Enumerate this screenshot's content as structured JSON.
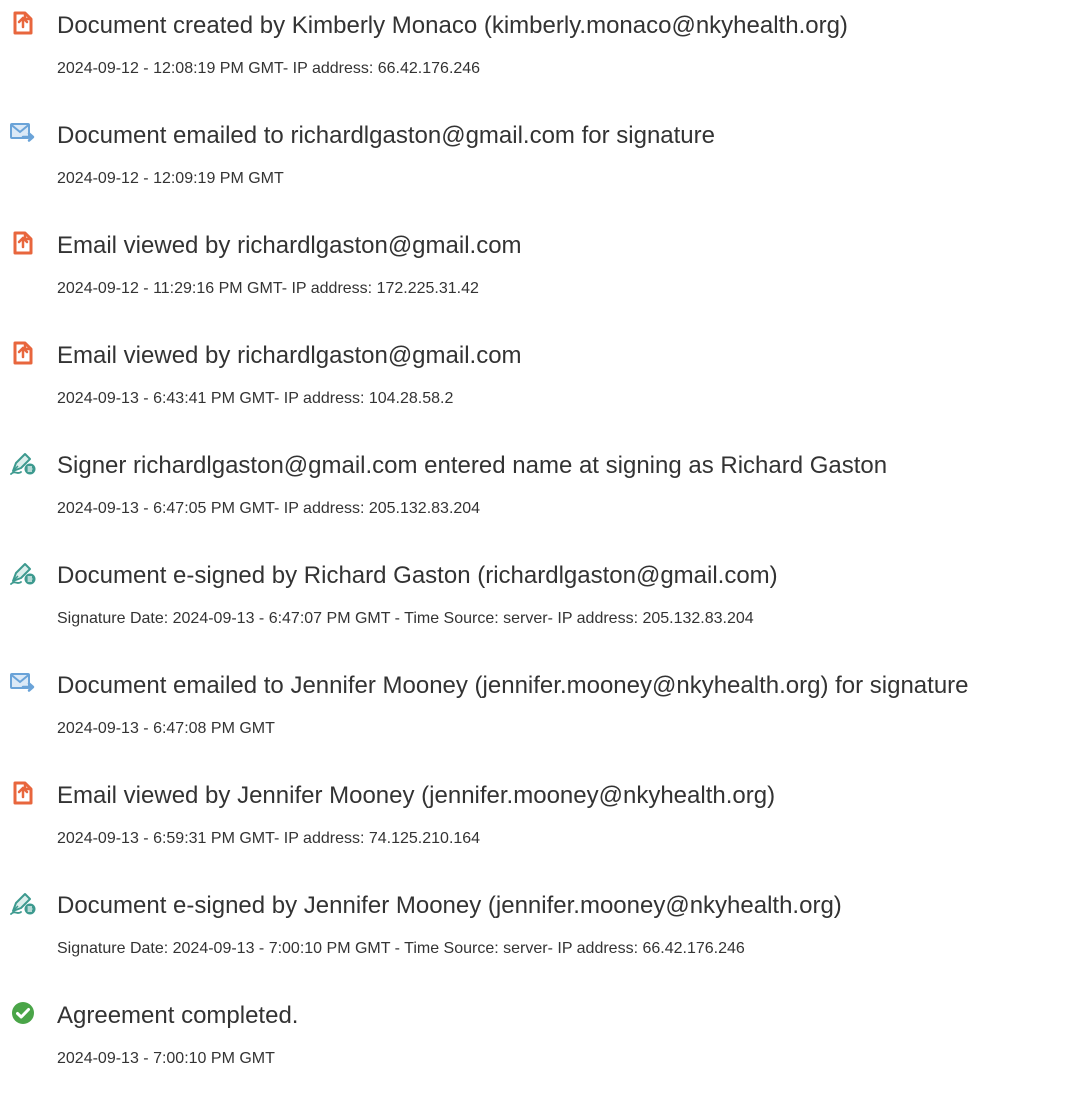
{
  "colors": {
    "doc_icon": "#e8663d",
    "email_icon": "#6aa3d8",
    "sign_icon": "#3d9a8f",
    "check_icon": "#4aa548"
  },
  "events": [
    {
      "icon": "document-icon",
      "title": "Document created by Kimberly Monaco (kimberly.monaco@nkyhealth.org)",
      "detail": "2024-09-12 - 12:08:19 PM GMT- IP address: 66.42.176.246"
    },
    {
      "icon": "email-icon",
      "title": "Document emailed to richardlgaston@gmail.com for signature",
      "detail": "2024-09-12 - 12:09:19 PM GMT"
    },
    {
      "icon": "document-icon",
      "title": "Email viewed by richardlgaston@gmail.com",
      "detail": "2024-09-12 - 11:29:16 PM GMT- IP address: 172.225.31.42"
    },
    {
      "icon": "document-icon",
      "title": "Email viewed by richardlgaston@gmail.com",
      "detail": "2024-09-13 - 6:43:41 PM GMT- IP address: 104.28.58.2"
    },
    {
      "icon": "pen-icon",
      "title": "Signer richardlgaston@gmail.com entered name at signing as Richard Gaston",
      "detail": "2024-09-13 - 6:47:05 PM GMT- IP address: 205.132.83.204"
    },
    {
      "icon": "pen-icon",
      "title": "Document e-signed by Richard Gaston (richardlgaston@gmail.com)",
      "detail": "Signature Date: 2024-09-13 - 6:47:07 PM GMT - Time Source: server- IP address: 205.132.83.204"
    },
    {
      "icon": "email-icon",
      "title": "Document emailed to Jennifer Mooney (jennifer.mooney@nkyhealth.org) for signature",
      "detail": "2024-09-13 - 6:47:08 PM GMT"
    },
    {
      "icon": "document-icon",
      "title": "Email viewed by Jennifer Mooney (jennifer.mooney@nkyhealth.org)",
      "detail": "2024-09-13 - 6:59:31 PM GMT- IP address: 74.125.210.164"
    },
    {
      "icon": "pen-icon",
      "title": "Document e-signed by Jennifer Mooney (jennifer.mooney@nkyhealth.org)",
      "detail": "Signature Date: 2024-09-13 - 7:00:10 PM GMT - Time Source: server- IP address: 66.42.176.246"
    },
    {
      "icon": "checkmark-icon",
      "title": "Agreement completed.",
      "detail": "2024-09-13 - 7:00:10 PM GMT"
    }
  ]
}
